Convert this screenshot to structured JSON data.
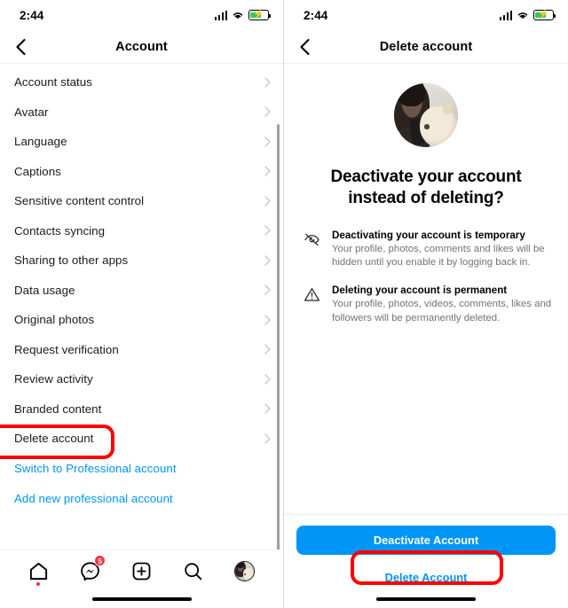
{
  "status_bar": {
    "time": "2:44",
    "signal_icon": "cellular-signal-icon",
    "wifi_icon": "wifi-icon",
    "battery_icon": "battery-charging-icon"
  },
  "left_screen": {
    "nav": {
      "back_icon": "chevron-left-icon",
      "title": "Account"
    },
    "items": [
      {
        "label": "Account status"
      },
      {
        "label": "Avatar"
      },
      {
        "label": "Language"
      },
      {
        "label": "Captions"
      },
      {
        "label": "Sensitive content control"
      },
      {
        "label": "Contacts syncing"
      },
      {
        "label": "Sharing to other apps"
      },
      {
        "label": "Data usage"
      },
      {
        "label": "Original photos"
      },
      {
        "label": "Request verification"
      },
      {
        "label": "Review activity"
      },
      {
        "label": "Branded content"
      },
      {
        "label": "Delete account"
      }
    ],
    "links": [
      {
        "label": "Switch to Professional account"
      },
      {
        "label": "Add new professional account"
      }
    ],
    "tabbar": {
      "home_icon": "home-icon",
      "messages_icon": "messenger-icon",
      "messages_badge": "5",
      "create_icon": "plus-square-icon",
      "search_icon": "search-icon",
      "profile_icon": "profile-avatar-icon"
    }
  },
  "right_screen": {
    "nav": {
      "back_icon": "chevron-left-icon",
      "title": "Delete account"
    },
    "avatar_icon": "user-profile-photo",
    "headline": "Deactivate your account instead of deleting?",
    "info_rows": [
      {
        "icon": "eye-off-icon",
        "title": "Deactivating your account is temporary",
        "text": "Your profile, photos, comments and likes will be hidden until you enable it by logging back in."
      },
      {
        "icon": "warning-triangle-icon",
        "title": "Deleting your account is permanent",
        "text": "Your profile, photos, videos, comments, likes and followers will be permanently deleted."
      }
    ],
    "deactivate_label": "Deactivate Account",
    "delete_label": "Delete Account"
  },
  "colors": {
    "accent_blue": "#0095f6",
    "highlight_red": "#ff0000",
    "badge_red": "#ff3040",
    "battery_green": "#34c759",
    "muted_text": "#737373"
  }
}
